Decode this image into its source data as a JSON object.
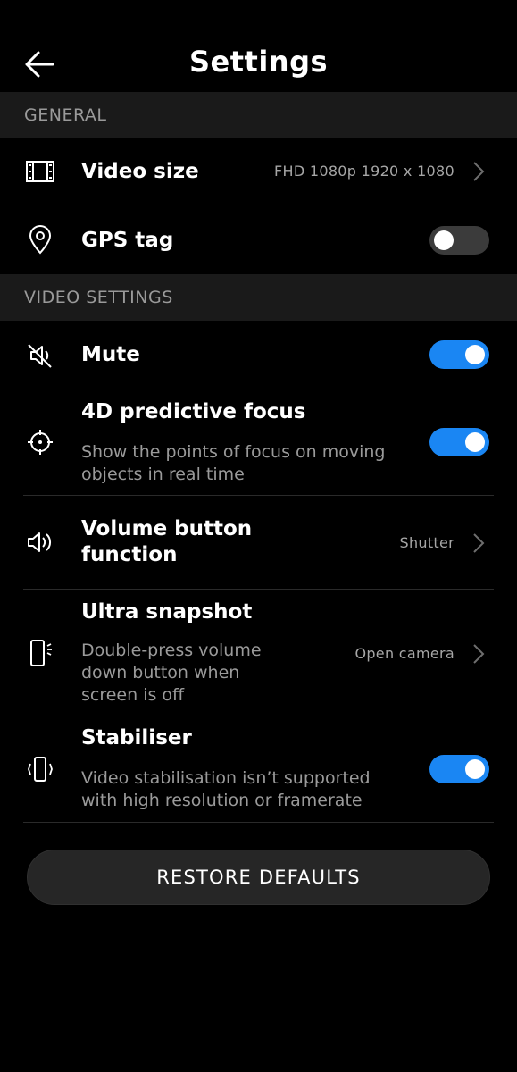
{
  "header": {
    "title": "Settings",
    "back_icon": "arrow-left-icon"
  },
  "sections": {
    "general": {
      "label": "GENERAL"
    },
    "video_settings": {
      "label": "VIDEO SETTINGS"
    }
  },
  "items": {
    "video_size": {
      "icon": "film-frame-icon",
      "title": "Video size",
      "value": "FHD 1080p 1920 x 1080"
    },
    "gps_tag": {
      "icon": "location-pin-icon",
      "title": "GPS tag",
      "toggle": "off"
    },
    "mute": {
      "icon": "speaker-muted-icon",
      "title": "Mute",
      "toggle": "on"
    },
    "predictive_focus": {
      "icon": "crosshair-icon",
      "title": "4D predictive focus",
      "subtitle_line1": "Show the points of focus on moving",
      "subtitle_line2": "objects in real time",
      "toggle": "on"
    },
    "volume_button": {
      "icon": "speaker-volume-icon",
      "title_line1": "Volume button",
      "title_line2": "function",
      "value": "Shutter"
    },
    "ultra_snapshot": {
      "icon": "phone-snapshot-icon",
      "title": "Ultra snapshot",
      "subtitle_line1": "Double-press volume",
      "subtitle_line2": "down button when",
      "subtitle_line3": "screen is off",
      "value": "Open camera"
    },
    "stabiliser": {
      "icon": "phone-vibrate-icon",
      "title": "Stabiliser",
      "subtitle_line1": "Video stabilisation isn’t supported",
      "subtitle_line2": "with high resolution or framerate",
      "toggle": "on"
    }
  },
  "footer": {
    "restore_label": "RESTORE DEFAULTS"
  },
  "colors": {
    "accent": "#1a86f3",
    "background": "#000000",
    "section_bg": "#1a1a1a",
    "secondary_text": "#9a9a9a"
  }
}
